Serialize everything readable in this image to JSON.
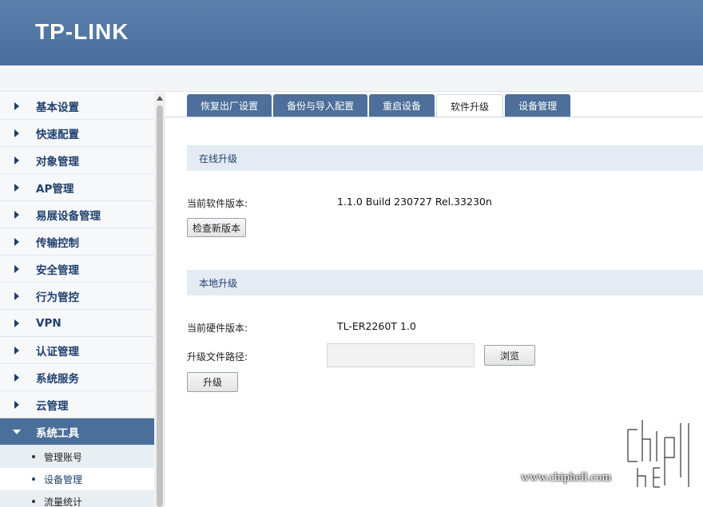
{
  "header": {
    "logo": "TP-LINK"
  },
  "sidebar": {
    "items": [
      {
        "label": "基本设置"
      },
      {
        "label": "快速配置"
      },
      {
        "label": "对象管理"
      },
      {
        "label": "AP管理"
      },
      {
        "label": "易展设备管理"
      },
      {
        "label": "传输控制"
      },
      {
        "label": "安全管理"
      },
      {
        "label": "行为管控"
      },
      {
        "label": "VPN"
      },
      {
        "label": "认证管理"
      },
      {
        "label": "系统服务"
      },
      {
        "label": "云管理"
      },
      {
        "label": "系统工具"
      }
    ],
    "sub_items": [
      {
        "label": "管理账号"
      },
      {
        "label": "设备管理"
      },
      {
        "label": "流量统计"
      }
    ]
  },
  "tabs": [
    {
      "label": "恢复出厂设置"
    },
    {
      "label": "备份与导入配置"
    },
    {
      "label": "重启设备"
    },
    {
      "label": "软件升级"
    },
    {
      "label": "设备管理"
    }
  ],
  "online": {
    "title": "在线升级",
    "version_label": "当前软件版本:",
    "version_value": "1.1.0 Build 230727 Rel.33230n",
    "check_button": "检查新版本"
  },
  "local": {
    "title": "本地升级",
    "hw_label": "当前硬件版本:",
    "hw_value": "TL-ER2260T 1.0",
    "path_label": "升级文件路径:",
    "path_value": "",
    "browse_button": "浏览",
    "upgrade_button": "升级"
  },
  "watermark": {
    "text": "www.chiphell.com"
  },
  "colors": {
    "accent": "#4b6f9b",
    "nav_text": "#20406e",
    "section_bg": "#e4ebf2"
  }
}
